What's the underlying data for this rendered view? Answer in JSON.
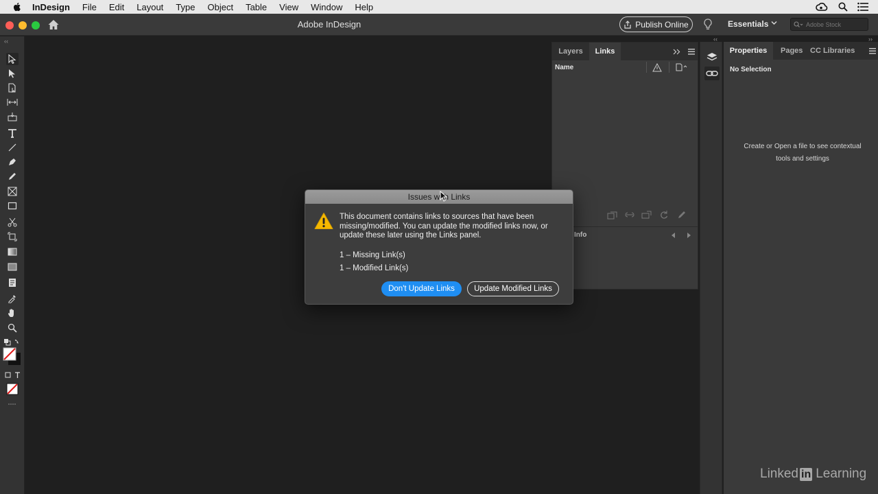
{
  "menubar": {
    "app_name": "InDesign",
    "items": [
      "File",
      "Edit",
      "Layout",
      "Type",
      "Object",
      "Table",
      "View",
      "Window",
      "Help"
    ]
  },
  "titlebar": {
    "title": "Adobe InDesign",
    "publish_label": "Publish Online",
    "workspace_label": "Essentials",
    "search_placeholder": "Adobe Stock"
  },
  "links_panel": {
    "tabs": [
      "Layers",
      "Links"
    ],
    "active_tab": "Links",
    "name_header": "Name",
    "info_label": "Info"
  },
  "properties_panel": {
    "tabs": [
      "Properties",
      "Pages",
      "CC Libraries"
    ],
    "active_tab": "Properties",
    "selection_label": "No Selection",
    "hint": "Create or Open a file to see contextual tools and settings"
  },
  "dialog": {
    "title": "Issues with Links",
    "message": "This document contains links to sources that have been missing/modified. You can update the modified links now, or update these later using the Links panel.",
    "missing_line": "1 – Missing Link(s)",
    "modified_line": "1 – Modified Link(s)",
    "primary_button": "Don't Update Links",
    "secondary_button": "Update Modified Links"
  },
  "watermark": {
    "text_left": "Linked",
    "text_badge": "in",
    "text_right": "Learning"
  },
  "colors": {
    "accent": "#1f8ef2",
    "warning": "#f5b800"
  }
}
